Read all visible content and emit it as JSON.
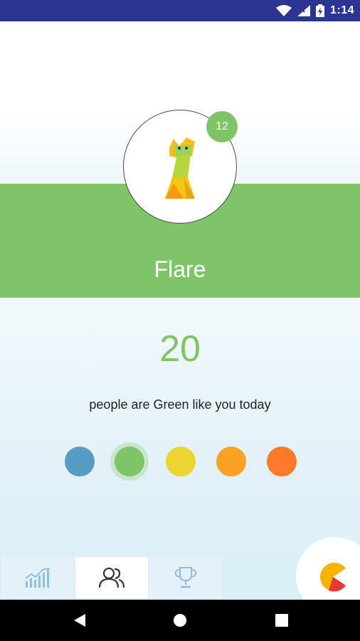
{
  "status_bar": {
    "time": "1:14",
    "icons": [
      "wifi-icon",
      "signal-icon",
      "battery-icon"
    ]
  },
  "profile": {
    "name": "Flare",
    "level": "12",
    "avatar_icon": "origami-cat-icon"
  },
  "stats": {
    "count": "20",
    "caption": "people are Green like you today"
  },
  "colors": {
    "brand_green": "#80c46a",
    "status_bar": "#2b3590",
    "options": [
      "#579dc3",
      "#80c46a",
      "#ecd433",
      "#fca222",
      "#fc7a2a"
    ],
    "selected_index": 1
  },
  "bottom_nav": {
    "tabs": [
      {
        "icon": "stats-chart-icon",
        "active": false
      },
      {
        "icon": "people-icon",
        "active": true
      },
      {
        "icon": "trophy-icon",
        "active": false
      }
    ]
  },
  "system_nav": {
    "buttons": [
      "back-icon",
      "home-icon",
      "recents-icon"
    ]
  }
}
